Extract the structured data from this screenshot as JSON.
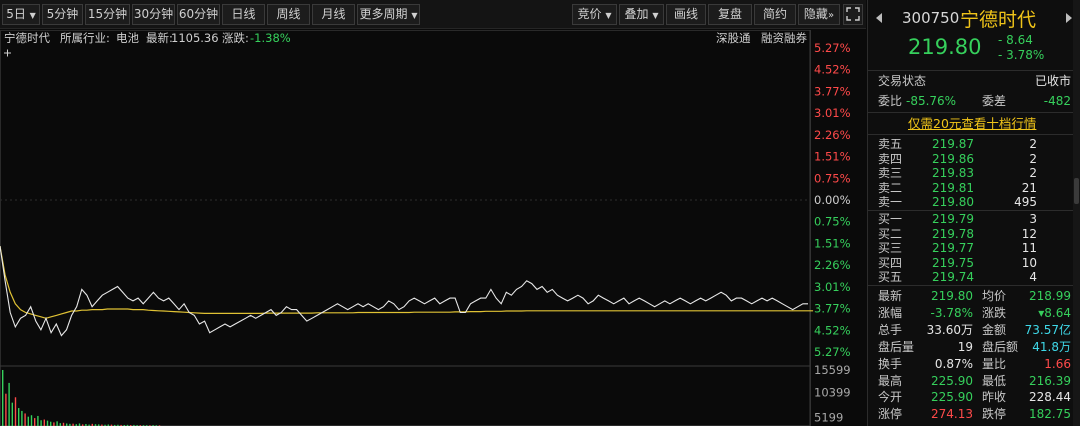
{
  "toolbar": {
    "period_5d": "5日",
    "m5": "5分钟",
    "m15": "15分钟",
    "m30": "30分钟",
    "m60": "60分钟",
    "day": "日线",
    "week": "周线",
    "month": "月线",
    "more": "更多周期",
    "bid": "竞价",
    "overlay": "叠加",
    "draw": "画线",
    "review": "复盘",
    "simple": "简约",
    "hide": "隐藏"
  },
  "info": {
    "name": "宁德时代",
    "industry_label": "所属行业:",
    "industry": "电池",
    "latest_label": "最新:",
    "latest": "1105.36",
    "change_label": "涨跌:",
    "change": "-1.38%",
    "sz_connect": "深股通",
    "margin": "融资融券"
  },
  "chart_data": {
    "type": "line",
    "y_axis_percent_labels": [
      "5.27%",
      "4.52%",
      "3.77%",
      "3.01%",
      "2.26%",
      "1.51%",
      "0.75%",
      "0.00%",
      "0.75%",
      "1.51%",
      "2.26%",
      "3.01%",
      "3.77%",
      "4.52%",
      "5.27%"
    ],
    "volume_labels": [
      "15599",
      "10399",
      "5199"
    ],
    "ylim_percent": [
      -5.27,
      5.27
    ],
    "series": [
      {
        "values": [
          -1.6,
          -2.8,
          -3.9,
          -4.4,
          -4.1,
          -4.0,
          -3.7,
          -4.2,
          -4.5,
          -4.1,
          -4.6,
          -4.3,
          -4.7,
          -4.5,
          -4.0,
          -3.7,
          -3.1,
          -3.3,
          -3.7,
          -3.5,
          -3.3,
          -3.2,
          -3.1,
          -3.0,
          -3.2,
          -3.4,
          -3.5,
          -3.4,
          -3.6,
          -3.4,
          -3.2,
          -3.4,
          -3.5,
          -3.4,
          -3.6,
          -3.8,
          -3.6,
          -3.9,
          -4.0,
          -4.3,
          -4.2,
          -4.6,
          -4.5,
          -4.4,
          -4.3,
          -4.4,
          -4.3,
          -4.2,
          -4.1,
          -4.0,
          -4.1,
          -4.0,
          -3.9,
          -3.8,
          -4.0,
          -3.9,
          -3.7,
          -3.8,
          -3.8,
          -4.0,
          -4.2,
          -4.1,
          -4.0,
          -3.9,
          -3.8,
          -3.7,
          -3.6,
          -3.7,
          -3.8,
          -3.7,
          -3.6,
          -3.7,
          -3.6,
          -3.7,
          -3.8,
          -3.7,
          -3.5,
          -3.6,
          -3.8,
          -3.7,
          -3.5,
          -3.4,
          -3.5,
          -3.6,
          -3.5,
          -3.4,
          -3.6,
          -3.5,
          -3.4,
          -3.4,
          -3.9,
          -3.9,
          -3.6,
          -3.5,
          -3.4,
          -3.4,
          -3.1,
          -3.4,
          -3.6,
          -3.2,
          -3.3,
          -3.1,
          -3.0,
          -2.8,
          -2.9,
          -3.1,
          -3.0,
          -3.2,
          -3.1,
          -3.3,
          -3.4,
          -3.5,
          -3.4,
          -3.3,
          -3.4,
          -3.6,
          -3.5,
          -3.3,
          -3.4,
          -3.5,
          -3.6,
          -3.5,
          -3.4,
          -3.6,
          -3.5,
          -3.4,
          -3.5,
          -3.6,
          -3.7,
          -3.6,
          -3.5,
          -3.6,
          -3.5,
          -3.4,
          -3.5,
          -3.6,
          -3.5,
          -3.4,
          -3.5,
          -3.4,
          -3.3,
          -3.2,
          -3.3,
          -3.5,
          -3.4,
          -3.4,
          -3.5,
          -3.6,
          -3.5,
          -3.4,
          -3.5,
          -3.4,
          -3.5,
          -3.6,
          -3.7,
          -3.8,
          -3.7,
          -3.6,
          -3.6
        ],
        "color": "#e8e8e8"
      },
      {
        "values": [
          -1.6,
          -2.6,
          -3.2,
          -3.6,
          -3.8,
          -3.9,
          -3.95,
          -4.0,
          -4.05,
          -4.1,
          -4.05,
          -4.0,
          -3.95,
          -3.9,
          -3.85,
          -3.85,
          -3.82,
          -3.82,
          -3.8,
          -3.8,
          -3.8,
          -3.78,
          -3.78,
          -3.78,
          -3.78,
          -3.78,
          -3.8,
          -3.8,
          -3.8,
          -3.82,
          -3.83,
          -3.84,
          -3.85,
          -3.86,
          -3.87,
          -3.88,
          -3.89,
          -3.9,
          -3.91,
          -3.92,
          -3.93,
          -3.93,
          -3.93,
          -3.93,
          -3.93,
          -3.93,
          -3.93,
          -3.93,
          -3.93,
          -3.93,
          -3.93,
          -3.93,
          -3.92,
          -3.92,
          -3.92,
          -3.92,
          -3.92,
          -3.92,
          -3.92,
          -3.92,
          -3.92,
          -3.92,
          -3.91,
          -3.91,
          -3.91,
          -3.91,
          -3.91,
          -3.91,
          -3.91,
          -3.91,
          -3.9,
          -3.9,
          -3.9,
          -3.9,
          -3.9,
          -3.9,
          -3.9,
          -3.9,
          -3.9,
          -3.9,
          -3.9,
          -3.89,
          -3.89,
          -3.89,
          -3.89,
          -3.89,
          -3.89,
          -3.89,
          -3.89,
          -3.88,
          -3.88,
          -3.88,
          -3.87,
          -3.87,
          -3.87,
          -3.86,
          -3.86,
          -3.86,
          -3.86,
          -3.85,
          -3.85,
          -3.85,
          -3.85,
          -3.84,
          -3.84,
          -3.84,
          -3.84,
          -3.84,
          -3.84,
          -3.84,
          -3.84,
          -3.84,
          -3.84,
          -3.84,
          -3.84,
          -3.84,
          -3.84,
          -3.84,
          -3.84,
          -3.84,
          -3.84,
          -3.84,
          -3.84,
          -3.84,
          -3.84,
          -3.84,
          -3.84,
          -3.84,
          -3.84,
          -3.84,
          -3.84,
          -3.84,
          -3.84,
          -3.84,
          -3.84,
          -3.84,
          -3.84,
          -3.84,
          -3.84,
          -3.84,
          -3.84,
          -3.84,
          -3.84,
          -3.84,
          -3.84,
          -3.84,
          -3.84,
          -3.84,
          -3.84,
          -3.84,
          -3.84,
          -3.84,
          -3.84,
          -3.84,
          -3.84,
          -3.84,
          -3.84,
          -3.84,
          -3.84,
          -3.84
        ],
        "color": "#e0c234"
      }
    ],
    "volume": [
      15599,
      9000,
      12000,
      6500,
      8000,
      5000,
      4200,
      3500,
      2600,
      3000,
      2200,
      2800,
      1600,
      1800,
      1500,
      1200,
      1000,
      1300,
      800,
      900,
      700,
      600,
      650,
      500,
      700,
      450,
      550,
      400,
      600,
      500,
      450,
      400,
      350,
      420,
      380,
      300,
      350,
      300,
      280,
      320,
      260,
      300,
      250,
      240,
      230,
      220,
      210,
      260,
      200,
      190
    ]
  },
  "panel": {
    "code": "300750",
    "name": "宁德时代",
    "price": "219.80",
    "change": "- 8.64",
    "change_pct": "- 3.78%",
    "trade_status_label": "交易状态",
    "trade_status": "已收市",
    "wei_bi_label": "委比",
    "wei_bi": "-85.76%",
    "wei_cha_label": "委差",
    "wei_cha": "-482",
    "promo": "仅需20元查看十档行情",
    "asks": [
      {
        "label": "卖五",
        "price": "219.87",
        "vol": "2"
      },
      {
        "label": "卖四",
        "price": "219.86",
        "vol": "2"
      },
      {
        "label": "卖三",
        "price": "219.83",
        "vol": "2"
      },
      {
        "label": "卖二",
        "price": "219.81",
        "vol": "21"
      },
      {
        "label": "卖一",
        "price": "219.80",
        "vol": "495"
      }
    ],
    "bids": [
      {
        "label": "买一",
        "price": "219.79",
        "vol": "3"
      },
      {
        "label": "买二",
        "price": "219.78",
        "vol": "12"
      },
      {
        "label": "买三",
        "price": "219.77",
        "vol": "11"
      },
      {
        "label": "买四",
        "price": "219.75",
        "vol": "10"
      },
      {
        "label": "买五",
        "price": "219.74",
        "vol": "4"
      }
    ],
    "stats": [
      {
        "l1": "最新",
        "v1": "219.80",
        "c1": "g",
        "l2": "均价",
        "v2": "218.99",
        "c2": "g"
      },
      {
        "l1": "涨幅",
        "v1": "-3.78%",
        "c1": "g",
        "l2": "涨跌",
        "v2": "▾8.64",
        "c2": "g"
      },
      {
        "l1": "总手",
        "v1": "33.60万",
        "c1": "w",
        "l2": "金额",
        "v2": "73.57亿",
        "c2": "cy"
      },
      {
        "l1": "盘后量",
        "v1": "19",
        "c1": "w",
        "l2": "盘后额",
        "v2": "41.8万",
        "c2": "cy"
      },
      {
        "l1": "换手",
        "v1": "0.87%",
        "c1": "w",
        "l2": "量比",
        "v2": "1.66",
        "c2": "r"
      },
      {
        "l1": "最高",
        "v1": "225.90",
        "c1": "g",
        "l2": "最低",
        "v2": "216.39",
        "c2": "g"
      },
      {
        "l1": "今开",
        "v1": "225.90",
        "c1": "g",
        "l2": "昨收",
        "v2": "228.44",
        "c2": "w"
      },
      {
        "l1": "涨停",
        "v1": "274.13",
        "c1": "r",
        "l2": "跌停",
        "v2": "182.75",
        "c2": "g"
      }
    ]
  }
}
